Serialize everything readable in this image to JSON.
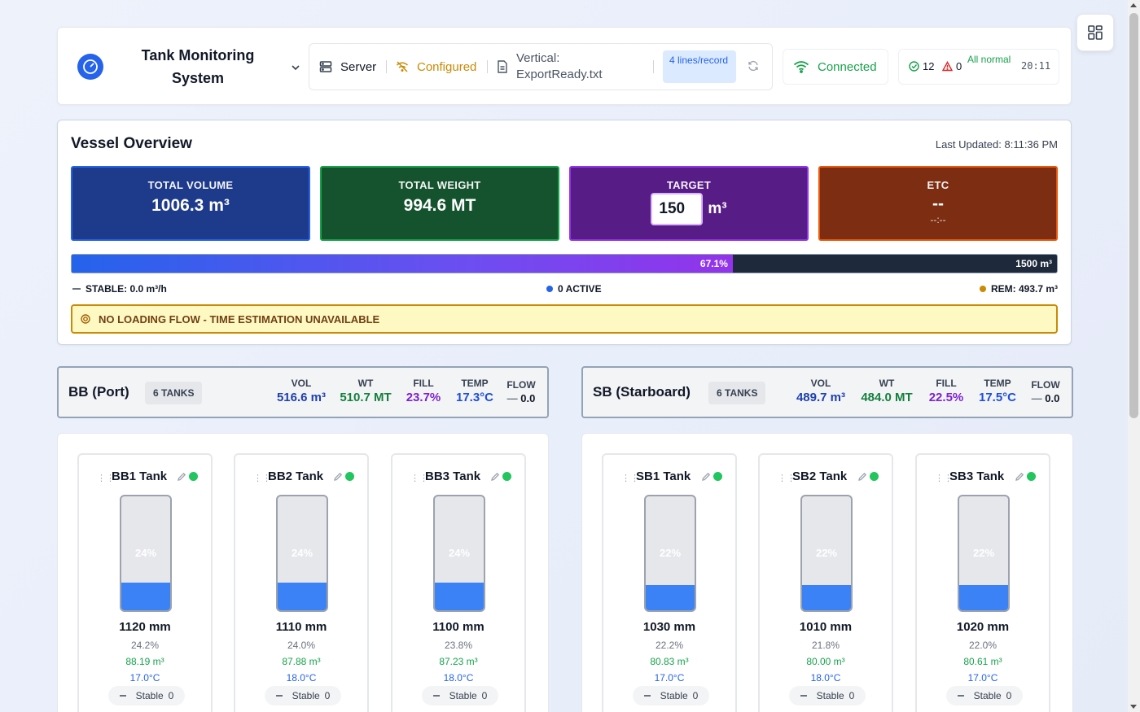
{
  "header": {
    "app_title": "Tank Monitoring System",
    "server_label": "Server",
    "config_status": "Configured",
    "file_label": "Vertical: ExportReady.txt",
    "lines_badge": "4 lines/record",
    "connection": "Connected",
    "ok_count": "12",
    "warn_count": "0",
    "status_text": "All normal",
    "clock": "20:11"
  },
  "overview": {
    "title": "Vessel Overview",
    "last_updated": "Last Updated: 8:11:36 PM",
    "cards": {
      "volume": {
        "label": "TOTAL VOLUME",
        "value": "1006.3 m³"
      },
      "weight": {
        "label": "TOTAL WEIGHT",
        "value": "994.6 MT"
      },
      "target": {
        "label": "TARGET",
        "input_value": "150",
        "unit": "m³"
      },
      "etc": {
        "label": "ETC",
        "value": "--",
        "sub": "--:--"
      }
    },
    "progress": {
      "percent": 67.1,
      "percent_label": "67.1%",
      "capacity_label": "1500 m³"
    },
    "stable": "STABLE: 0.0 m³/h",
    "active": "0 ACTIVE",
    "remaining": "REM: 493.7 m³",
    "warning": "NO LOADING FLOW - TIME ESTIMATION UNAVAILABLE",
    "colors": {
      "volume": "#1e3a8a",
      "weight": "#14532d",
      "target": "#581c87",
      "etc": "#7c2d12"
    }
  },
  "sides": [
    {
      "name": "BB (Port)",
      "tank_count": "6 TANKS",
      "vol_label": "VOL",
      "vol": "516.6 m³",
      "wt_label": "WT",
      "wt": "510.7 MT",
      "fill_label": "FILL",
      "fill": "23.7%",
      "temp_label": "TEMP",
      "temp": "17.3°C",
      "flow_label": "FLOW",
      "flow": "0.0",
      "tanks": [
        {
          "name": "BB1 Tank",
          "fill": 24,
          "fill_label": "24%",
          "level": "1120 mm",
          "pct": "24.2%",
          "vol": "88.19 m³",
          "temp": "17.0°C",
          "flow_status": "Stable",
          "flow_value": "0"
        },
        {
          "name": "BB2 Tank",
          "fill": 24,
          "fill_label": "24%",
          "level": "1110 mm",
          "pct": "24.0%",
          "vol": "87.88 m³",
          "temp": "18.0°C",
          "flow_status": "Stable",
          "flow_value": "0"
        },
        {
          "name": "BB3 Tank",
          "fill": 24,
          "fill_label": "24%",
          "level": "1100 mm",
          "pct": "23.8%",
          "vol": "87.23 m³",
          "temp": "18.0°C",
          "flow_status": "Stable",
          "flow_value": "0"
        }
      ]
    },
    {
      "name": "SB (Starboard)",
      "tank_count": "6 TANKS",
      "vol_label": "VOL",
      "vol": "489.7 m³",
      "wt_label": "WT",
      "wt": "484.0 MT",
      "fill_label": "FILL",
      "fill": "22.5%",
      "temp_label": "TEMP",
      "temp": "17.5°C",
      "flow_label": "FLOW",
      "flow": "0.0",
      "tanks": [
        {
          "name": "SB1 Tank",
          "fill": 22,
          "fill_label": "22%",
          "level": "1030 mm",
          "pct": "22.2%",
          "vol": "80.83 m³",
          "temp": "17.0°C",
          "flow_status": "Stable",
          "flow_value": "0"
        },
        {
          "name": "SB2 Tank",
          "fill": 22,
          "fill_label": "22%",
          "level": "1010 mm",
          "pct": "21.8%",
          "vol": "80.00 m³",
          "temp": "18.0°C",
          "flow_status": "Stable",
          "flow_value": "0"
        },
        {
          "name": "SB3 Tank",
          "fill": 22,
          "fill_label": "22%",
          "level": "1020 mm",
          "pct": "22.0%",
          "vol": "80.61 m³",
          "temp": "17.0°C",
          "flow_status": "Stable",
          "flow_value": "0"
        }
      ]
    }
  ]
}
